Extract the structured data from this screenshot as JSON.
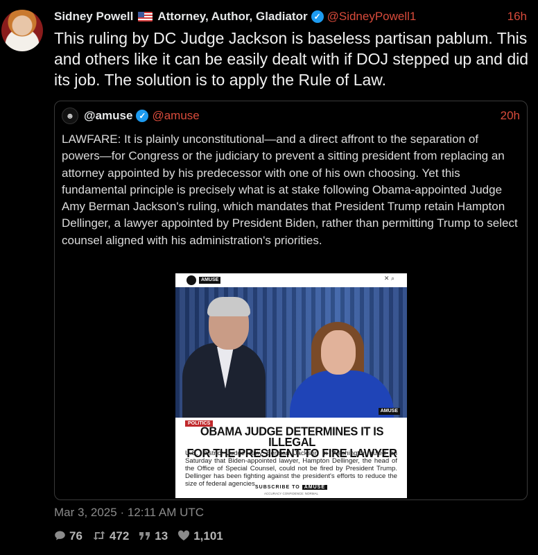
{
  "tweet": {
    "author_name": "Sidney Powell",
    "author_title": "Attorney, Author, Gladiator",
    "handle": "@SidneyPowell1",
    "time": "16h",
    "text": "This ruling by DC Judge Jackson is baseless partisan pablum. This and others like it can be easily dealt with if DOJ stepped up and did its job.  The solution is to apply the Rule of Law.",
    "timestamp": "Mar 3, 2025 · 12:11 AM UTC"
  },
  "quoted_tweet": {
    "author_name": "@amuse",
    "handle": "@amuse",
    "time": "20h",
    "text": "LAWFARE: It is plainly unconstitutional—and a direct affront to the separation of powers—for Congress or the judiciary to prevent a sitting president from replacing an attorney appointed by his predecessor with one of his own choosing. Yet this fundamental principle is precisely what is at stake following Obama-appointed Judge Amy Berman Jackson's ruling, which mandates that President Trump retain Hampton Dellinger, a lawyer appointed by President Biden, rather than permitting Trump to select counsel aligned with his administration's priorities.",
    "image": {
      "logo": "AMUSE",
      "tag": "POLITICS",
      "headline_line1": "OBAMA JUDGE DETERMINES IT IS ILLEGAL",
      "headline_line2": "FOR THE PRESIDENT TO FIRE LAWYER",
      "body": "U.S. District Judge Amy Berman Jackson in Washington ruled on Saturday that Biden-appointed lawyer, Hampton Dellinger, the head of the Office of Special Counsel, could not be fired by President Trump. Dellinger has been fighting against the president's efforts to reduce the size of federal agencies.",
      "subscribe_label": "SUBSCRIBE TO",
      "subscribe_logo": "AMUSE",
      "accuracy": "ACCURACY CONFIDENCE: NORMAL"
    }
  },
  "stats": {
    "replies": "76",
    "retweets": "472",
    "quotes": "13",
    "likes": "1,101"
  },
  "colors": {
    "handle": "#d94b3b",
    "verified": "#1d9bf0",
    "background": "#000000"
  },
  "icons": {
    "replies": "comment-icon",
    "retweets": "retweet-icon",
    "quotes": "quote-icon",
    "likes": "heart-icon"
  }
}
